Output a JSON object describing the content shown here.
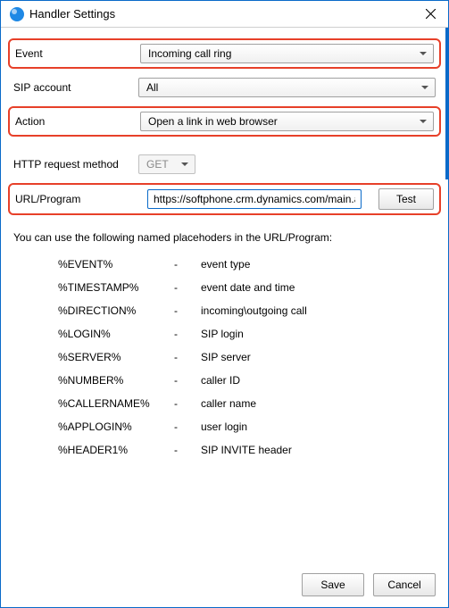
{
  "window": {
    "title": "Handler Settings"
  },
  "fields": {
    "event_label": "Event",
    "event_value": "Incoming call ring",
    "sip_label": "SIP account",
    "sip_value": "All",
    "action_label": "Action",
    "action_value": "Open a link in web browser",
    "http_label": "HTTP request method",
    "http_value": "GET",
    "url_label": "URL/Program",
    "url_value": "https://softphone.crm.dynamics.com/main.aspx?.",
    "test_label": "Test"
  },
  "placeholders": {
    "intro": "You can use the following named placehoders in the URL/Program:",
    "rows": [
      {
        "key": "%EVENT%",
        "desc": "event type"
      },
      {
        "key": "%TIMESTAMP%",
        "desc": "event date and time"
      },
      {
        "key": "%DIRECTION%",
        "desc": "incoming\\outgoing call"
      },
      {
        "key": "%LOGIN%",
        "desc": "SIP login"
      },
      {
        "key": "%SERVER%",
        "desc": "SIP server"
      },
      {
        "key": "%NUMBER%",
        "desc": "caller ID"
      },
      {
        "key": "%CALLERNAME%",
        "desc": "caller name"
      },
      {
        "key": "%APPLOGIN%",
        "desc": "user login"
      },
      {
        "key": "%HEADER1%",
        "desc": "SIP INVITE header"
      }
    ]
  },
  "buttons": {
    "save": "Save",
    "cancel": "Cancel"
  }
}
